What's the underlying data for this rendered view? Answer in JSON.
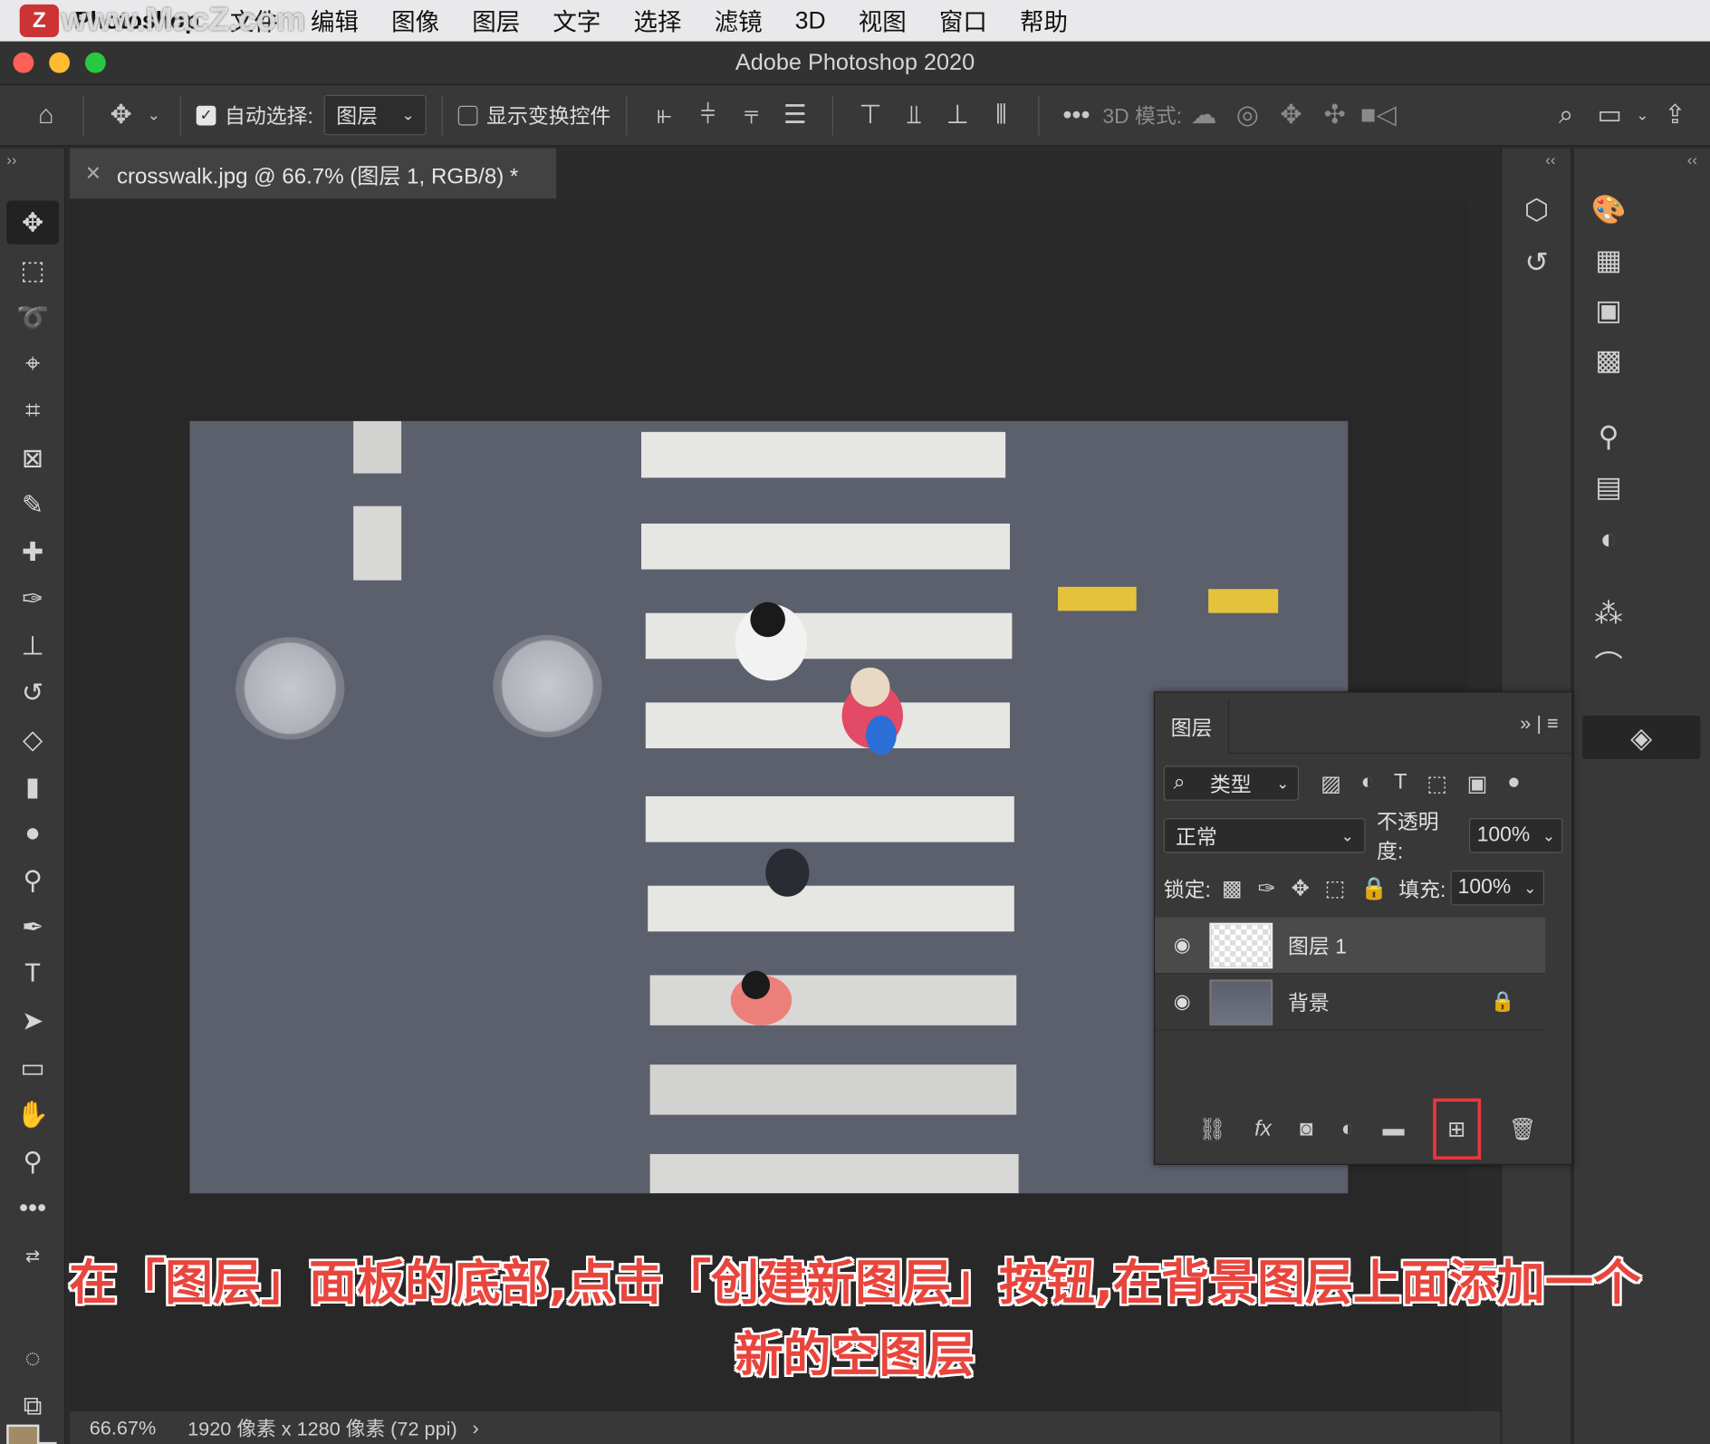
{
  "menubar": {
    "app_logo": "Z",
    "app_name": "Photoshop",
    "watermark": "www.MacZ.com",
    "items": [
      "文件",
      "编辑",
      "图像",
      "图层",
      "文字",
      "选择",
      "滤镜",
      "3D",
      "视图",
      "窗口",
      "帮助"
    ]
  },
  "window": {
    "title": "Adobe Photoshop 2020"
  },
  "options": {
    "auto_select_label": "自动选择:",
    "auto_select_value": "图层",
    "show_transform_label": "显示变换控件",
    "mode_3d_label": "3D 模式:"
  },
  "document": {
    "tab_title": "crosswalk.jpg @ 66.7% (图层 1, RGB/8) *"
  },
  "status": {
    "zoom": "66.67%",
    "dimensions": "1920 像素 x 1280 像素 (72 ppi)"
  },
  "layers_panel": {
    "tab_label": "图层",
    "filter_kind": "类型",
    "blend_mode": "正常",
    "opacity_label": "不透明度:",
    "opacity_value": "100%",
    "lock_label": "锁定:",
    "fill_label": "填充:",
    "fill_value": "100%",
    "layers": [
      {
        "name": "图层 1",
        "selected": true,
        "locked": false
      },
      {
        "name": "背景",
        "selected": false,
        "locked": true
      }
    ]
  },
  "caption": {
    "line1": "在「图层」面板的底部,点击「创建新图层」按钮,在背景图层上面添加一个",
    "line2": "新的空图层"
  },
  "colors": {
    "accent_highlight": "#e8383d",
    "foreground_swatch": "#a38a66",
    "background_swatch": "#000000"
  }
}
